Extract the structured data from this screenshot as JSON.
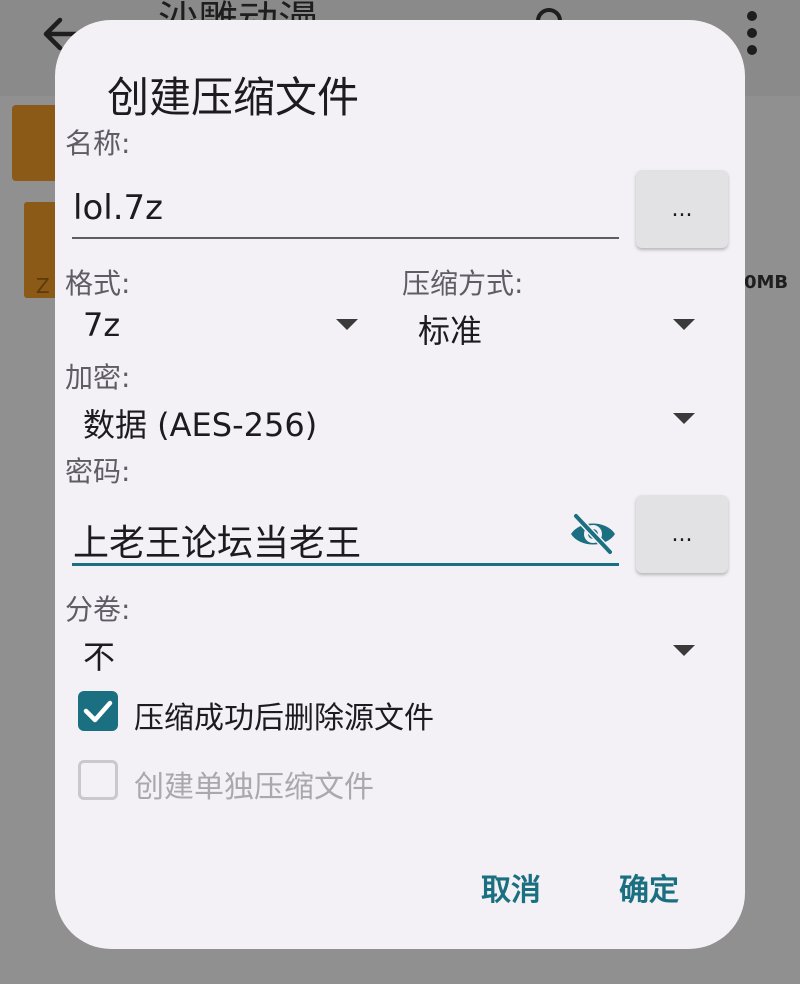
{
  "background": {
    "title": "沙雕动漫",
    "size_text": "0MB",
    "file_badge": "Z"
  },
  "dialog": {
    "title": "创建压缩文件",
    "name_label": "名称:",
    "name_value": "lol.7z",
    "browse_label": "...",
    "format_label": "格式:",
    "format_value": "7z",
    "compression_label": "压缩方式:",
    "compression_value": "标准",
    "encryption_label": "加密:",
    "encryption_value": "数据 (AES-256)",
    "password_label": "密码:",
    "password_value": "上老王论坛当老王",
    "password_browse_label": "...",
    "split_label": "分卷:",
    "split_value": "不",
    "delete_source_label": "压缩成功后删除源文件",
    "delete_source_checked": true,
    "separate_archives_label": "创建单独压缩文件",
    "separate_archives_checked": false,
    "cancel_label": "取消",
    "ok_label": "确定"
  },
  "colors": {
    "accent": "#1a6f80",
    "dialog_bg": "#f3f1f5",
    "scrim": "#8e8e8e",
    "folder": "#8a5a16"
  }
}
